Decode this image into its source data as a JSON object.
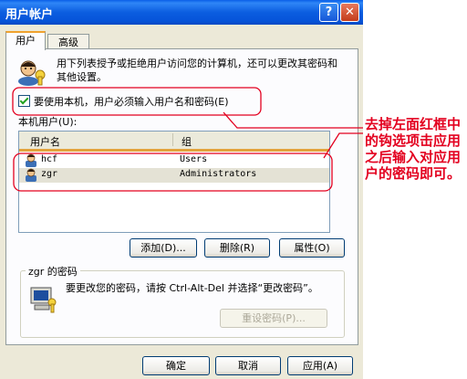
{
  "window": {
    "title": "用户帐户"
  },
  "titlebar": {
    "help_glyph": "?",
    "close_glyph": "✕"
  },
  "tabs": [
    {
      "label": "用户"
    },
    {
      "label": "高级"
    }
  ],
  "intro_text": "用下列表授予或拒绝用户访问您的计算机，还可以更改其密码和其他设置。",
  "require_login_checkbox": {
    "label": "要使用本机，用户必须输入用户名和密码(E)",
    "checked": true
  },
  "local_users_label": "本机用户(U):",
  "table": {
    "columns": [
      "用户名",
      "组"
    ],
    "rows": [
      {
        "name": "hcf",
        "group": "Users",
        "selected": false
      },
      {
        "name": "zgr",
        "group": "Administrators",
        "selected": true
      }
    ]
  },
  "list_buttons": {
    "add": "添加(D)...",
    "delete": "删除(R)",
    "properties": "属性(O)"
  },
  "password_group": {
    "title": "zgr 的密码",
    "text": "要更改您的密码，请按 Ctrl-Alt-Del 并选择“更改密码”。",
    "reset_button": "重设密码(P)..."
  },
  "dialog_buttons": {
    "ok": "确定",
    "cancel": "取消",
    "apply": "应用(A)"
  },
  "annotation": {
    "text": "去掉左面红框中的钩选项击应用之后输入对应用户的密码即可。",
    "color": "#E3001F"
  },
  "colors": {
    "titlebar": "#0A5FE8",
    "dialog_bg": "#ECE9D8",
    "tab_accent": "#F0A22E"
  }
}
